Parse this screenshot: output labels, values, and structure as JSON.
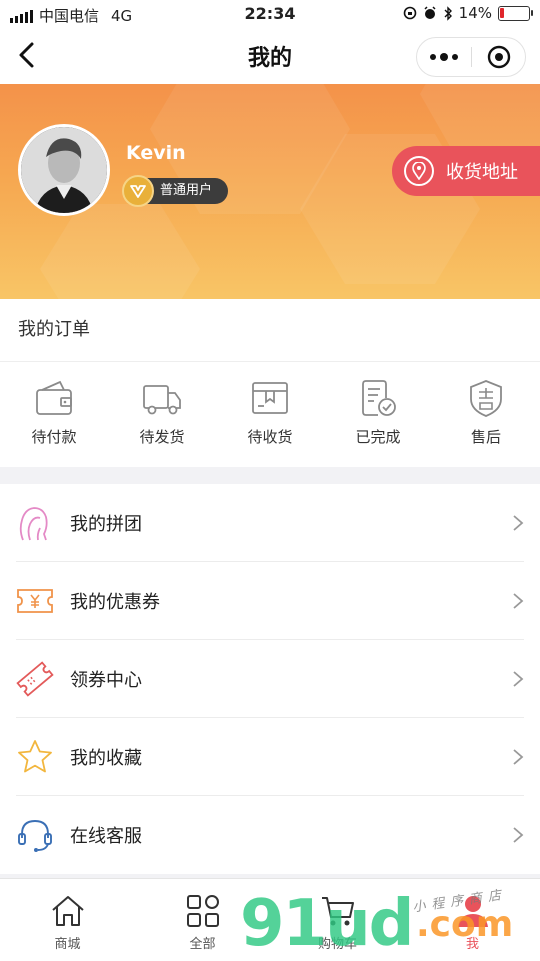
{
  "status_bar": {
    "carrier": "中国电信",
    "network": "4G",
    "time": "22:34",
    "battery_text": "14%",
    "battery_level": 0.14
  },
  "nav": {
    "title": "我的"
  },
  "profile": {
    "username": "Kevin",
    "member_level": "普通用户",
    "address_button": "收货地址"
  },
  "orders": {
    "title": "我的订单",
    "items": [
      {
        "label": "待付款",
        "icon": "wallet-icon"
      },
      {
        "label": "待发货",
        "icon": "truck-icon"
      },
      {
        "label": "待收货",
        "icon": "package-icon"
      },
      {
        "label": "已完成",
        "icon": "completed-icon"
      },
      {
        "label": "售后",
        "icon": "after-sales-shield-icon"
      }
    ]
  },
  "menu": [
    {
      "label": "我的拼团",
      "icon": "group-buy-icon",
      "color": "#e48ac6"
    },
    {
      "label": "我的优惠券",
      "icon": "coupon-icon",
      "color": "#f0934a"
    },
    {
      "label": "领券中心",
      "icon": "ticket-icon",
      "color": "#e35a5a"
    },
    {
      "label": "我的收藏",
      "icon": "star-icon",
      "color": "#f2b63e"
    },
    {
      "label": "在线客服",
      "icon": "headset-icon",
      "color": "#3a6fb5"
    }
  ],
  "tabbar": [
    {
      "label": "商城",
      "icon": "home-icon"
    },
    {
      "label": "全部",
      "icon": "grid-icon"
    },
    {
      "label": "购物车",
      "icon": "cart-icon"
    },
    {
      "label": "我",
      "icon": "user-icon",
      "active": true
    }
  ],
  "colors": {
    "accent": "#e9535b",
    "banner_top": "#f4924a",
    "banner_bottom": "#f8c566"
  },
  "watermark": {
    "brand": "91ud",
    "domain": ".com",
    "tagline": "小程序商店"
  }
}
